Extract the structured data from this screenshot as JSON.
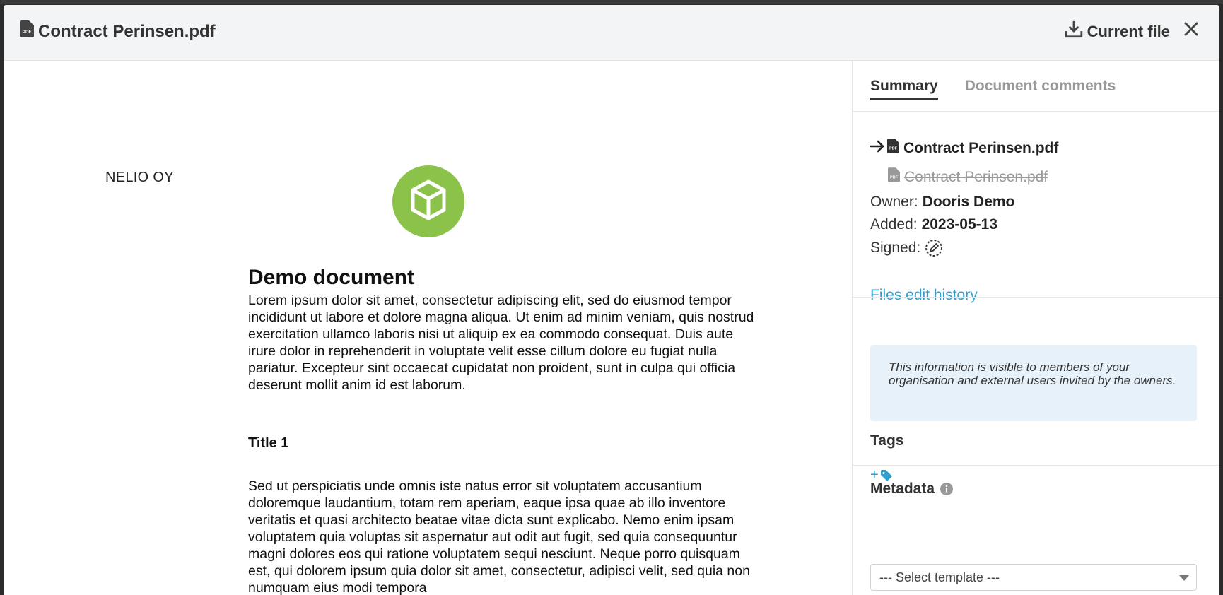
{
  "header": {
    "title": "Contract Perinsen.pdf",
    "download_label": "Current file"
  },
  "document": {
    "company": "NELIO OY",
    "title": "Demo document",
    "paragraph1": "Lorem ipsum dolor sit amet, consectetur adipiscing elit, sed do eiusmod tempor incididunt ut labore et dolore magna aliqua. Ut enim ad minim veniam, quis nostrud exercitation ullamco laboris nisi ut aliquip ex ea commodo consequat. Duis aute irure dolor in reprehenderit in voluptate velit esse cillum dolore eu fugiat nulla pariatur. Excepteur sint occaecat cupidatat non proident, sunt in culpa qui officia deserunt mollit anim id est laborum.",
    "subtitle": "Title 1",
    "paragraph2": "Sed ut perspiciatis unde omnis iste natus error sit voluptatem accusantium doloremque laudantium, totam rem aperiam, eaque ipsa quae ab illo inventore veritatis et quasi architecto beatae vitae dicta sunt explicabo. Nemo enim ipsam voluptatem quia voluptas sit aspernatur aut odit aut fugit, sed quia consequuntur magni dolores eos qui ratione voluptatem sequi nesciunt. Neque porro quisquam est, qui dolorem ipsum quia dolor sit amet, consectetur, adipisci velit, sed quia non numquam eius modi tempora"
  },
  "sidebar": {
    "tabs": [
      {
        "label": "Summary",
        "active": true
      },
      {
        "label": "Document comments",
        "active": false
      }
    ],
    "current_file": "Contract Perinsen.pdf",
    "previous_file": "Contract Perinsen.pdf",
    "owner_label": "Owner:",
    "owner_value": "Dooris Demo",
    "added_label": "Added:",
    "added_value": "2023-05-13",
    "signed_label": "Signed:",
    "history_link": "Files edit history",
    "info_text": "This information is visible to members of your organisation and external users invited by the owners.",
    "tags_title": "Tags",
    "tag_add": "+",
    "metadata_title": "Metadata",
    "template_select": "--- Select template ---"
  },
  "colors": {
    "accent": "#2e9fd0",
    "logo": "#8bc24a",
    "info_bg": "#e6f1fa"
  }
}
